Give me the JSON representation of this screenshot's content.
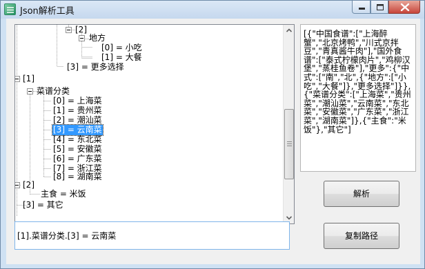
{
  "window": {
    "title": "Json解析工具"
  },
  "tree": {
    "nodes": [
      {
        "label": "[2]"
      },
      {
        "label": "地方"
      },
      {
        "label": "[0] = 小吃"
      },
      {
        "label": "[1] = 大餐"
      },
      {
        "label": "[3] = 更多选择"
      },
      {
        "label": "[1]"
      },
      {
        "label": "菜谱分类"
      },
      {
        "label": "[0] = 上海菜"
      },
      {
        "label": "[1] = 贵州菜"
      },
      {
        "label": "[2] = 潮汕菜"
      },
      {
        "label": "[3] = 云南菜"
      },
      {
        "label": "[4] = 东北菜"
      },
      {
        "label": "[5] = 安徽菜"
      },
      {
        "label": "[6] = 广东菜"
      },
      {
        "label": "[7] = 浙江菜"
      },
      {
        "label": "[8] = 湖南菜"
      },
      {
        "label": "[2]"
      },
      {
        "label": "主食 = 米饭"
      },
      {
        "label": "[3] = 其它"
      }
    ],
    "selected_index": 10
  },
  "json_text": "[{\"中国食谱\":[\"上海醉蟹\",\"北京烤鸭\",\"川式京拌豆\",\"青真酱牛肉\"],\"国外食谱\":[\"泰式柠檬肉片\",\"鸡柳汉堡\",\"蒸桂鱼卷\"],\"更多\":{\"中式\":[\"南\",\"北\",{\"地方\":[\"小吃\",\"大餐\"]},\"更多选择\"]}},{\"菜谱分类\":[\"上海菜\",\"贵州菜\",\"潮汕菜\",\"云南菜\",\"东北菜\",\"安徽菜\",\"广东菜\",\"浙江菜\",\"湖南菜\"]},{\"主食\":\"米饭\"},\"其它\"]",
  "buttons": {
    "parse": "解析",
    "copy_path": "复制路径"
  },
  "path_text": "[1].菜谱分类.[3] = 云南菜",
  "scrollbar": {
    "position_fraction": 0.55
  }
}
